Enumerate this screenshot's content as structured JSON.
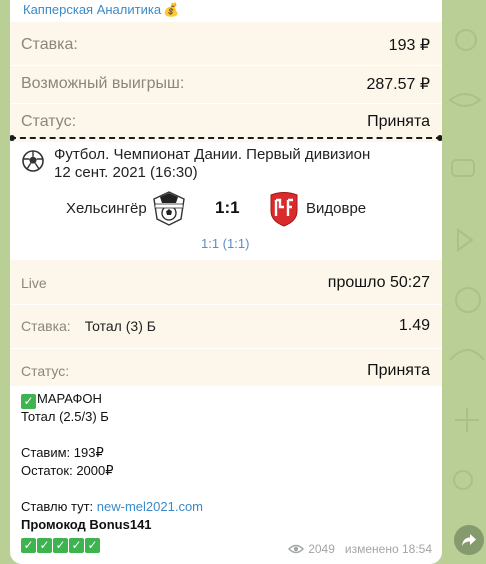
{
  "channel": {
    "name": "Капперская Аналитика",
    "emoji": "💰"
  },
  "ticket": {
    "rows": [
      {
        "label": "Ставка:",
        "value": "193 ₽"
      },
      {
        "label": "Возможный выигрыш:",
        "value": "287.57 ₽"
      },
      {
        "label": "Статус:",
        "value": "Принята"
      }
    ],
    "event": {
      "league": "Футбол. Чемпионат Дании. Первый дивизион",
      "datetime": "12 сент. 2021 (16:30)",
      "home_team": "Хельсингёр",
      "away_team": "Видовре",
      "score": "1:1",
      "halftime": "1:1 (1:1)"
    },
    "live": {
      "label": "Live",
      "elapsed": "прошло 50:27"
    },
    "bet": {
      "label": "Ставка:",
      "market": "Тотал (3) Б",
      "odds": "1.49"
    },
    "status": {
      "label": "Статус:",
      "value": "Принята"
    }
  },
  "message": {
    "bookmaker_check": "✓",
    "bookmaker": "МАРАФОН",
    "total": "Тотал (2.5/3) Б",
    "stake_line": "Ставим: 193₽",
    "balance_line": "Остаток: 2000₽",
    "place_label": "Ставлю тут:",
    "place_link": "new-mel2021.com",
    "promo": "Промокод Bonus141",
    "checks": [
      "✓",
      "✓",
      "✓",
      "✓",
      "✓"
    ]
  },
  "meta": {
    "views": "2049",
    "edited": "изменено 18:54"
  },
  "colors": {
    "accent": "#3a8ac8",
    "ticket_bg": "#fcf7ea",
    "wallpaper": "#b9cf95",
    "check_green": "#3fb34f"
  },
  "icons": {
    "views": "eye-icon",
    "forward": "share-arrow-icon",
    "sport": "football-icon"
  }
}
